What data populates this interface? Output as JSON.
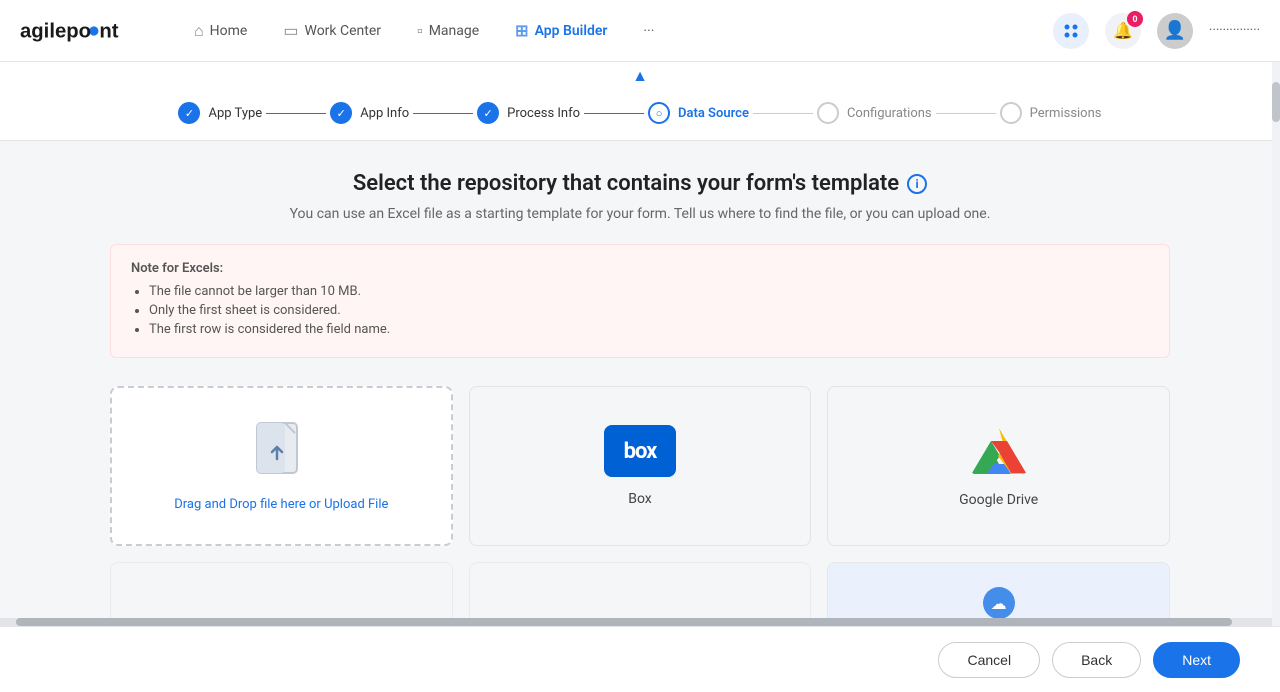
{
  "brand": {
    "logo_text": "agilepoint"
  },
  "navbar": {
    "home_label": "Home",
    "workcenter_label": "Work Center",
    "manage_label": "Manage",
    "appbuilder_label": "App Builder",
    "more_label": "···",
    "notification_count": "0",
    "username": "···············"
  },
  "stepper": {
    "toggle_icon": "▲",
    "steps": [
      {
        "id": "app-type",
        "label": "App Type",
        "state": "completed"
      },
      {
        "id": "app-info",
        "label": "App Info",
        "state": "completed"
      },
      {
        "id": "process-info",
        "label": "Process Info",
        "state": "completed"
      },
      {
        "id": "data-source",
        "label": "Data Source",
        "state": "active"
      },
      {
        "id": "configurations",
        "label": "Configurations",
        "state": "inactive"
      },
      {
        "id": "permissions",
        "label": "Permissions",
        "state": "inactive"
      }
    ]
  },
  "page": {
    "title": "Select the repository that contains your form's template",
    "subtitle": "You can use an Excel file as a starting template for your form. Tell us where to find the file, or you can upload one.",
    "info_icon": "i"
  },
  "note": {
    "title": "Note for Excels:",
    "items": [
      "The file cannot be larger than 10 MB.",
      "Only the first sheet is considered.",
      "The first row is considered the field name."
    ]
  },
  "cards": [
    {
      "id": "upload",
      "type": "upload",
      "drag_label": "Drag and Drop file here or ",
      "upload_link": "Upload File"
    },
    {
      "id": "box",
      "type": "box",
      "label": "Box"
    },
    {
      "id": "google-drive",
      "type": "gdrive",
      "label": "Google Drive"
    }
  ],
  "footer": {
    "cancel_label": "Cancel",
    "back_label": "Back",
    "next_label": "Next"
  }
}
